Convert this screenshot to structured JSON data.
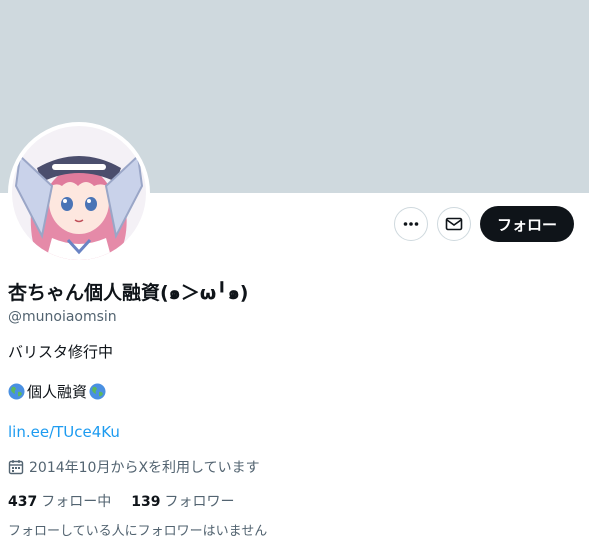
{
  "profile": {
    "display_name": "杏ちゃん個人融資(๑＞ω╹๑)",
    "handle": "@munoiaomsin",
    "bio_line1": "バリスタ修行中",
    "bio_line2": "個人融資",
    "link": "lin.ee/TUce4Ku",
    "joined": "2014年10月からXを利用しています",
    "following_count": "437",
    "following_label": "フォロー中",
    "followers_count": "139",
    "followers_label": "フォロワー",
    "mutual_note": "フォローしている人にフォロワーはいません"
  },
  "actions": {
    "more_icon": "more-icon",
    "message_icon": "envelope-icon",
    "follow_label": "フォロー"
  },
  "colors": {
    "banner": "#cfd9de",
    "link": "#1d9bf0",
    "secondary_text": "#536471",
    "follow_button": "#0f1419"
  }
}
